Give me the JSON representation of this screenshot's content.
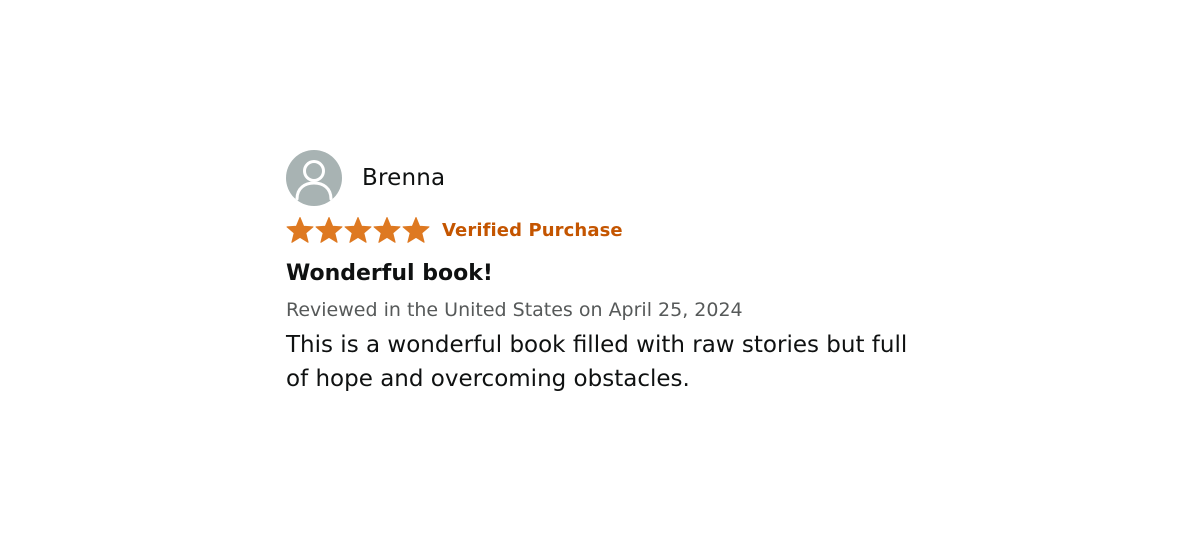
{
  "reviewer": {
    "name": "Brenna",
    "avatar_icon": "user-silhouette-icon",
    "avatar_bg_color": "#a8b3b3"
  },
  "rating": {
    "stars": 5,
    "max_stars": 5,
    "star_color": "#de7921",
    "verified_label": "Verified Purchase",
    "verified_color": "#c45500"
  },
  "review": {
    "title": "Wonderful book!",
    "date_line": "Reviewed in the United States on April 25, 2024",
    "body": "This is a wonderful book filled with raw stories but full of hope and overcoming obstacles."
  }
}
